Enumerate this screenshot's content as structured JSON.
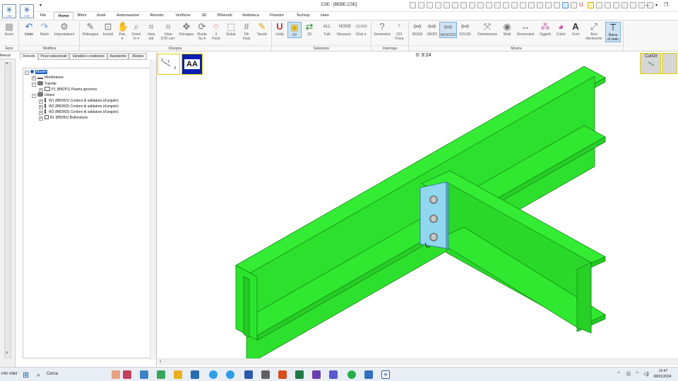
{
  "window": {
    "title": "CSE - [BEBE.CSE]",
    "logo_label": "CSE"
  },
  "menu_tabs": [
    "File",
    "Home",
    "Bfem",
    "Jnodi",
    "Automazione",
    "Renodo",
    "Verifiche",
    "3D",
    "PRenodi",
    "Nodoteca",
    "Finestre",
    "Technip",
    "Hare"
  ],
  "ribbon": {
    "azzera_label": "Azzer",
    "groups": {
      "modifica": "Modifica",
      "disegna": "Disegna",
      "selezione": "Selezione",
      "interroga": "Interroga",
      "mostra": "Mostra",
      "azze": "Azze"
    },
    "modifica": [
      {
        "label": "Undo",
        "icon": "undo-icon"
      },
      {
        "label": "Redo",
        "icon": "redo-icon"
      },
      {
        "label": "Impostazioni",
        "icon": "settings-icon"
      }
    ],
    "disegna": [
      {
        "label": "Ridisegna",
        "icon": "pencil-icon"
      },
      {
        "label": "Includi",
        "icon": "fit-icon"
      },
      {
        "label": "Pan",
        "sub": "▾",
        "icon": "hand-icon"
      },
      {
        "label": "Zoom",
        "sub": "In ▾",
        "icon": "zoom-icon"
      },
      {
        "label": "Vista",
        "sub": "std",
        "icon": "view-std-icon"
      },
      {
        "label": "Vista",
        "sub": "STD corr.",
        "icon": "view-corr-icon"
      },
      {
        "label": "Rimappa",
        "icon": "remap-icon"
      },
      {
        "label": "Ruota",
        "sub": "Su ▾",
        "icon": "rotate-icon"
      },
      {
        "label": "3",
        "sub": "Punti",
        "icon": "three-points-icon"
      },
      {
        "label": "Estrai",
        "icon": "extract-icon"
      },
      {
        "label": "Fili",
        "sub": "Fissi",
        "icon": "wires-icon"
      },
      {
        "label": "Tavole",
        "icon": "drawings-icon"
      }
    ],
    "selezione": [
      {
        "label": "Unità",
        "icon": "unit-icon"
      },
      {
        "label": "0D",
        "icon": "zero-d-icon"
      },
      {
        "label": "1D",
        "icon": "one-d-icon"
      },
      {
        "label": "ALL",
        "sub": "Tutti",
        "icon": "all-icon"
      },
      {
        "label": "NONE",
        "sub": "Nessuno",
        "icon": "none-icon"
      },
      {
        "label": "CLICK!",
        "sub": "Click ▾",
        "icon": "click-icon"
      }
    ],
    "interroga": [
      {
        "label": "Geometria",
        "icon": "geometry-icon"
      },
      {
        "label": "Trova",
        "sub": "123",
        "icon": "find-icon"
      }
    ],
    "mostra": [
      {
        "label": "BFEM",
        "icon": "bfem-icon"
      },
      {
        "label": "JNODI",
        "icon": "jnodi-icon"
      },
      {
        "label": "RENODO",
        "icon": "renodo-icon"
      },
      {
        "label": "SOLIDI",
        "icon": "solidi-icon"
      },
      {
        "label": "Orientazione",
        "icon": "orientation-icon"
      },
      {
        "label": "Modi",
        "icon": "modes-icon"
      },
      {
        "label": "Dimensioni",
        "icon": "dimensions-icon"
      },
      {
        "label": "Oggetti",
        "icon": "objects-icon"
      },
      {
        "label": "Colori",
        "icon": "colors-icon"
      },
      {
        "label": "Font",
        "icon": "font-icon"
      },
      {
        "label": "Assi",
        "sub": "riferimento",
        "icon": "axes-icon"
      },
      {
        "label": "Barra",
        "sub": "di stato",
        "icon": "statusbar-icon"
      }
    ]
  },
  "left_strip": {
    "tab": "Renod"
  },
  "panel": {
    "tabs": [
      "Renodo",
      "Pezzi selezionati",
      "Variabili e condizioni",
      "Assistente",
      "JNodes"
    ],
    "tree": [
      {
        "label": "Master",
        "level": 0,
        "highlight": true
      },
      {
        "label": "Membrature",
        "level": 1
      },
      {
        "label": "Tramite",
        "level": 1
      },
      {
        "label": "P1 (BB2P1) Piastra generica",
        "level": 2
      },
      {
        "label": "Unioni",
        "level": 1
      },
      {
        "label": "W1 (BB2W1) Cordoni di saldatura (d'angolo)",
        "level": 2
      },
      {
        "label": "W2 (BB2W2) Cordoni di saldatura (d'angolo)",
        "level": 2
      },
      {
        "label": "W3 (BB2W3) Cordoni di saldatura (d'angolo)",
        "level": 2
      },
      {
        "label": "B1 (BB2B1) Bullonatura",
        "level": 2
      }
    ]
  },
  "viewport": {
    "counter": "0: 9:24",
    "axis_z": "Z",
    "axis_y": "Y",
    "axis_x": "X",
    "view_badge": "AA",
    "cube_label": "CurDir",
    "colors": {
      "steel": "#2fe62f",
      "steel_dark": "#1b9e1b",
      "plate": "#8fd6ee",
      "bolt": "#b0b0b0"
    }
  },
  "taskbar": {
    "left_text": "Per inter",
    "search": "Cerca",
    "time": "12:47",
    "date": "08/01/2024"
  }
}
